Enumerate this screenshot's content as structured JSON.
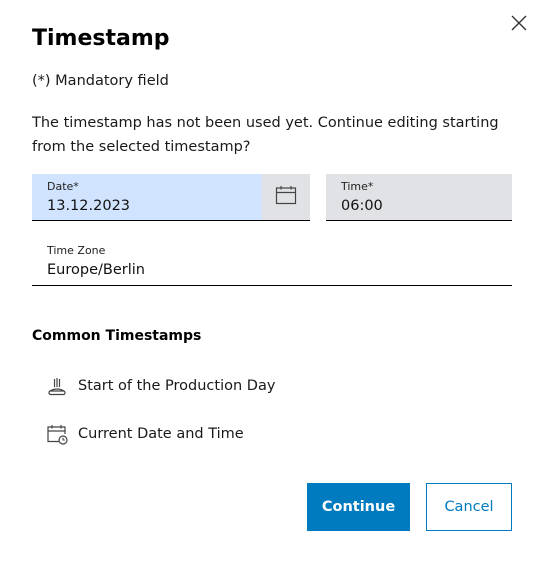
{
  "dialog": {
    "title": "Timestamp",
    "mandatory_note": "(*) Mandatory field",
    "message": "The timestamp has not been used yet. Continue editing starting from the selected timestamp?"
  },
  "fields": {
    "date": {
      "label": "Date*",
      "value": "13.12.2023"
    },
    "time": {
      "label": "Time*",
      "value": "06:00"
    },
    "timezone": {
      "label": "Time Zone",
      "value": "Europe/Berlin"
    }
  },
  "common_timestamps": {
    "title": "Common Timestamps",
    "items": [
      {
        "label": "Start of the Production Day",
        "icon": "production-start-icon"
      },
      {
        "label": "Current Date and Time",
        "icon": "calendar-clock-icon"
      }
    ]
  },
  "actions": {
    "continue_label": "Continue",
    "cancel_label": "Cancel"
  },
  "colors": {
    "primary": "#007bc0",
    "date_field_bg": "#d1e4ff",
    "field_bg": "#e0e2e5"
  }
}
